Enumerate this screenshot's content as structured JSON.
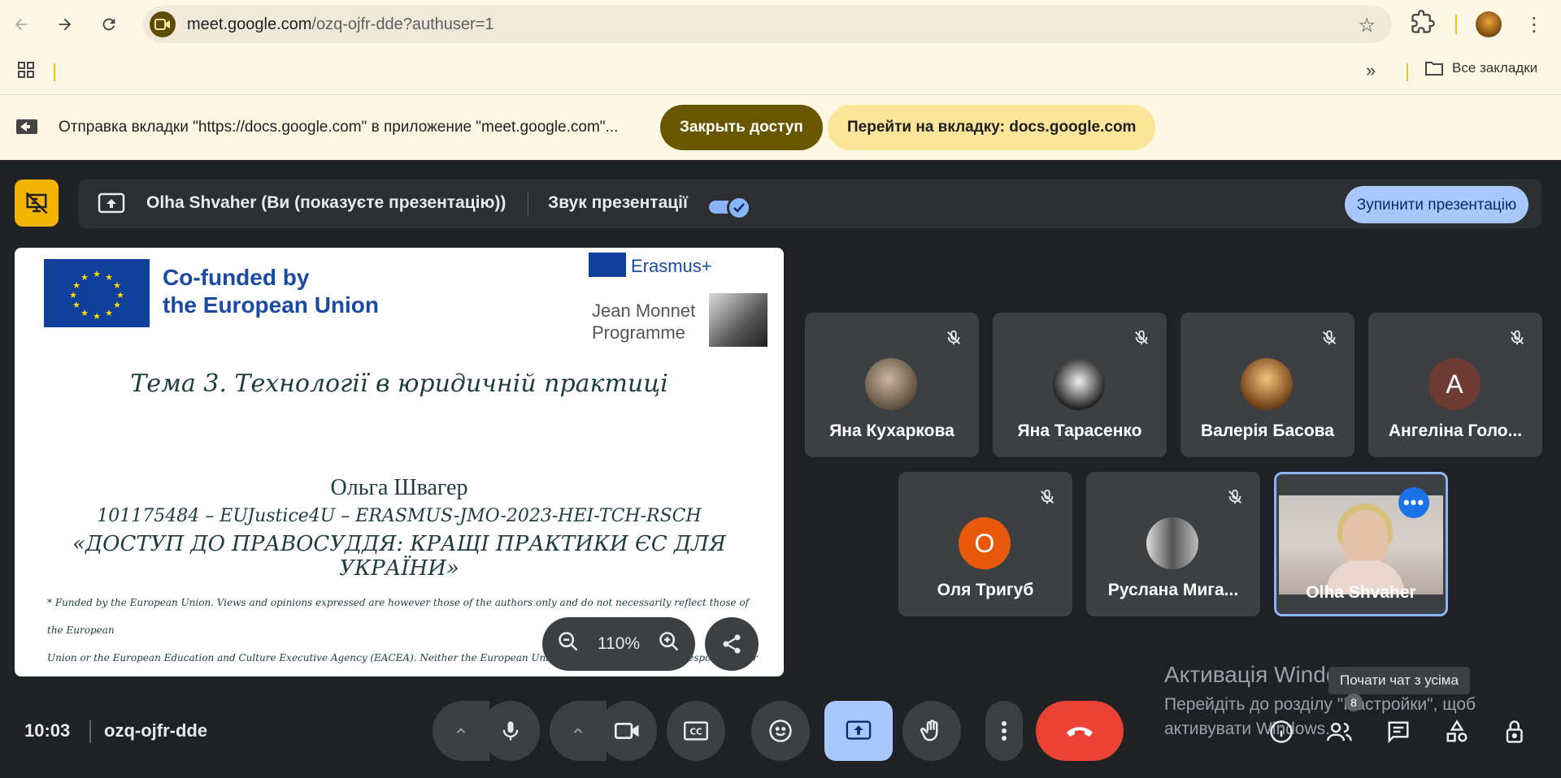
{
  "browser": {
    "url_host": "meet.google.com",
    "url_path": "/ozq-ojfr-dde?authuser=1",
    "all_bookmarks": "Все закладки"
  },
  "infobar": {
    "text": "Отправка вкладки \"https://docs.google.com\" в приложение \"meet.google.com\"...",
    "stop_share": "Закрыть доступ",
    "goto_tab": "Перейти на вкладку: docs.google.com"
  },
  "present_bar": {
    "presenter": "Olha Shvaher (Ви (показуєте презентацію))",
    "sound_label": "Звук презентації",
    "sound_on": true,
    "stop_presenting": "Зупинити презентацію"
  },
  "slide": {
    "cofunded_line1": "Co-funded by",
    "cofunded_line2": "the European Union",
    "erasmus": "Erasmus+",
    "jm_line1": "Jean Monnet",
    "jm_line2": "Programme",
    "title": "Тема 3. Технології в юридичній практиці",
    "author": "Ольга Швагер",
    "code": "101175484 – EUJustice4U – ERASMUS-JMO-2023-HEI-TCH-RSCH",
    "project": "«ДОСТУП ДО ПРАВОСУДДЯ: КРАЩІ ПРАКТИКИ ЄС ДЛЯ УКРАЇНИ»",
    "footnote_line1": "* Funded by the European Union. Views and opinions expressed are however those of the authors  only and do not necessarily reflect those of the European",
    "footnote_line2": "Union or the European Education and Culture Executive Agency (EACEA). Neither the European Union nor EACEA can be held responsible for them.",
    "zoom": "110%"
  },
  "participants": [
    {
      "name": "Яна Кухаркова",
      "initial": "",
      "avatar_color": "#8a7a6a"
    },
    {
      "name": "Яна Тарасенко",
      "initial": "",
      "avatar_color": "#d8d8d8"
    },
    {
      "name": "Валерія Басова",
      "initial": "",
      "avatar_color": "#b07a3a"
    },
    {
      "name": "Ангеліна Голо...",
      "initial": "А",
      "avatar_color": "#6d3b31"
    },
    {
      "name": "Оля Тригуб",
      "initial": "О",
      "avatar_color": "#e8590c"
    },
    {
      "name": "Руслана Мига...",
      "initial": "",
      "avatar_color": "#9a9a9a"
    },
    {
      "name": "Olha Shvaher",
      "initial": "",
      "avatar_color": ""
    }
  ],
  "bottom": {
    "time": "10:03",
    "meeting_code": "ozq-ojfr-dde",
    "participants_count": "8"
  },
  "windows": {
    "heading": "Активація Windows",
    "subtext": "Перейдіть до розділу \"Настройки\", щоб активувати Windows."
  },
  "tooltip": "Почати чат з усіма"
}
